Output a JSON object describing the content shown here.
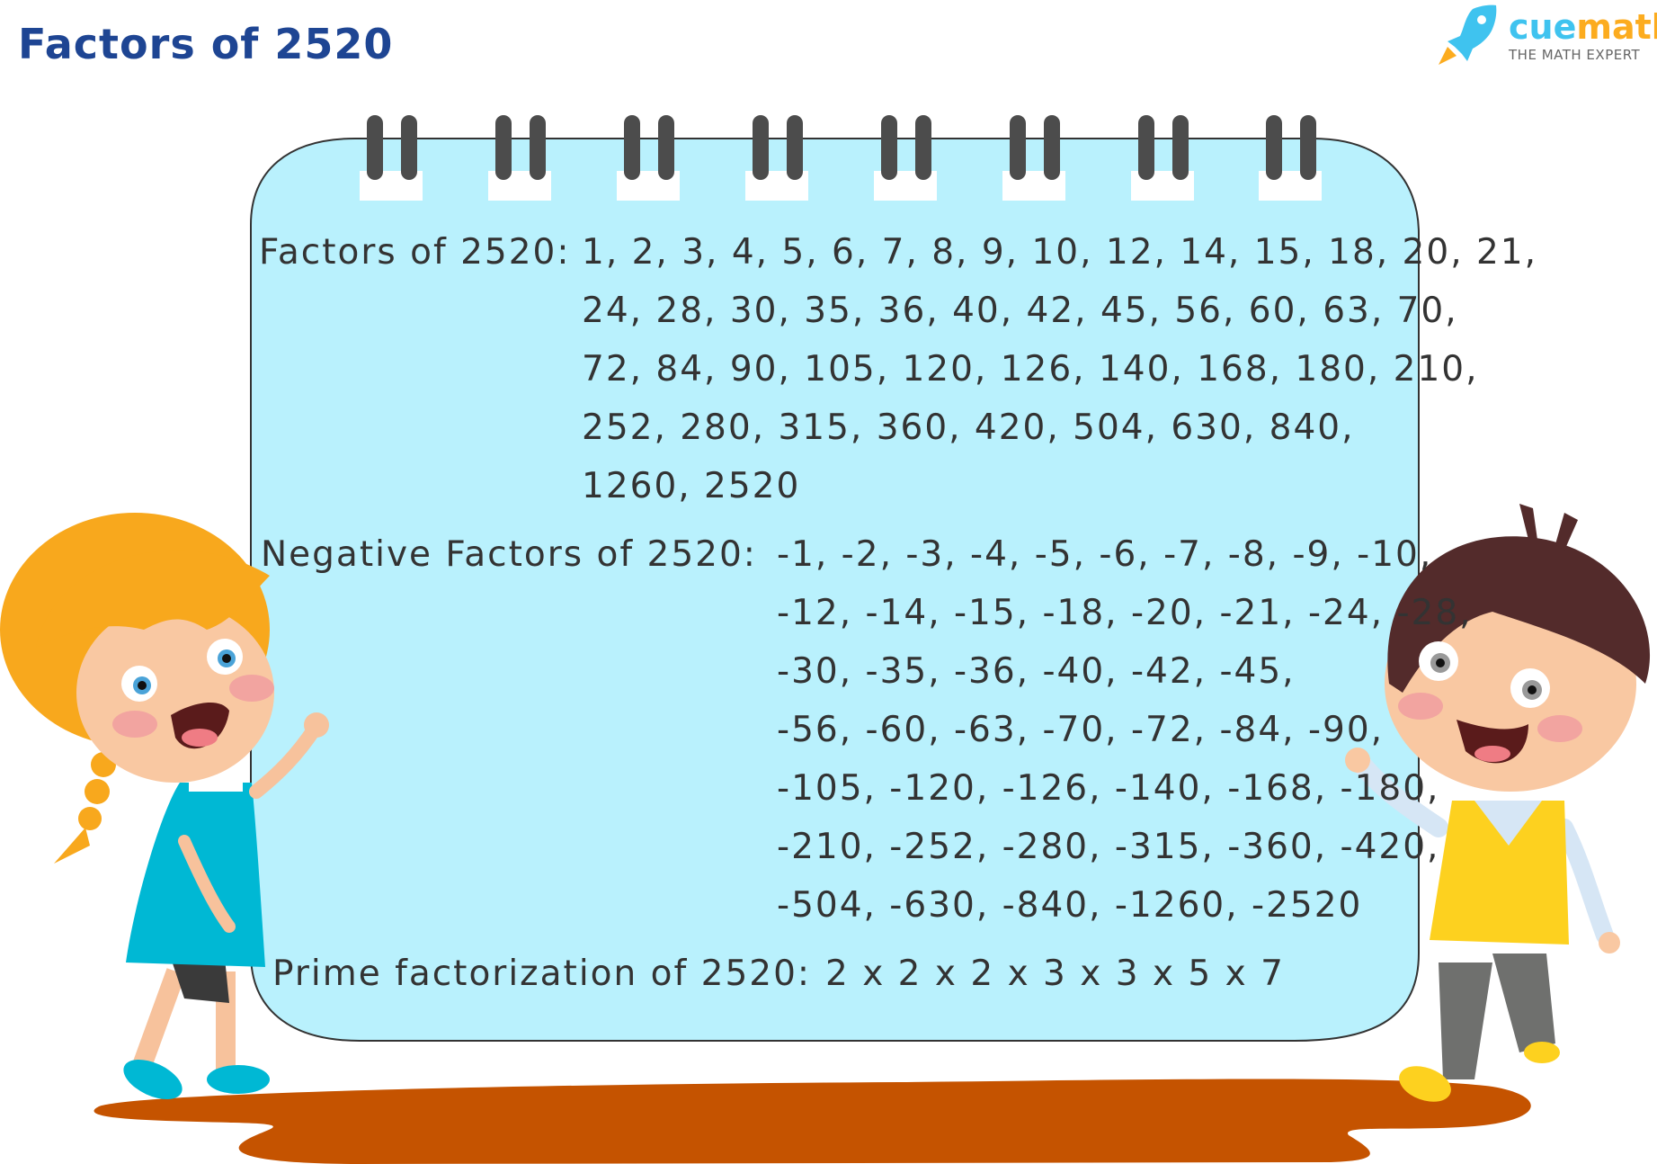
{
  "header": {
    "title": "Factors of 2520"
  },
  "logo": {
    "brand_part1": "cue",
    "brand_part2": "math",
    "tagline": "THE MATH EXPERT",
    "icon": "rocket-icon",
    "colors": {
      "cue": "#3fc3ef",
      "math": "#fcac1f"
    }
  },
  "board": {
    "background": "#b9f1fd",
    "factors": {
      "label": "Factors of 2520:",
      "lines": [
        "1, 2, 3, 4, 5, 6, 7, 8, 9, 10, 12, 14, 15, 18, 20, 21,",
        "24, 28, 30, 35, 36, 40, 42, 45, 56, 60, 63, 70,",
        "72, 84, 90, 105, 120, 126, 140, 168, 180, 210,",
        "252, 280, 315, 360, 420, 504, 630, 840,",
        "1260, 2520"
      ]
    },
    "negative_factors": {
      "label": "Negative Factors of 2520:",
      "lines": [
        "-1, -2, -3, -4, -5, -6, -7, -8, -9, -10,",
        "-12, -14, -15, -18, -20, -21, -24, -28,",
        "-30, -35, -36, -40, -42, -45,",
        "-56, -60, -63, -70, -72, -84, -90,",
        "-105, -120, -126, -140, -168, -180,",
        "-210, -252, -280, -315, -360, -420,",
        "-504, -630, -840, -1260, -2520"
      ]
    },
    "prime_factorization": {
      "label": "Prime factorization of 2520:",
      "value": "2 x 2 x 2 x 3 x 3 x 5 x 7"
    }
  },
  "illustration": {
    "left_character": "girl-waving",
    "right_character": "boy-waving",
    "ground": "puddle"
  }
}
